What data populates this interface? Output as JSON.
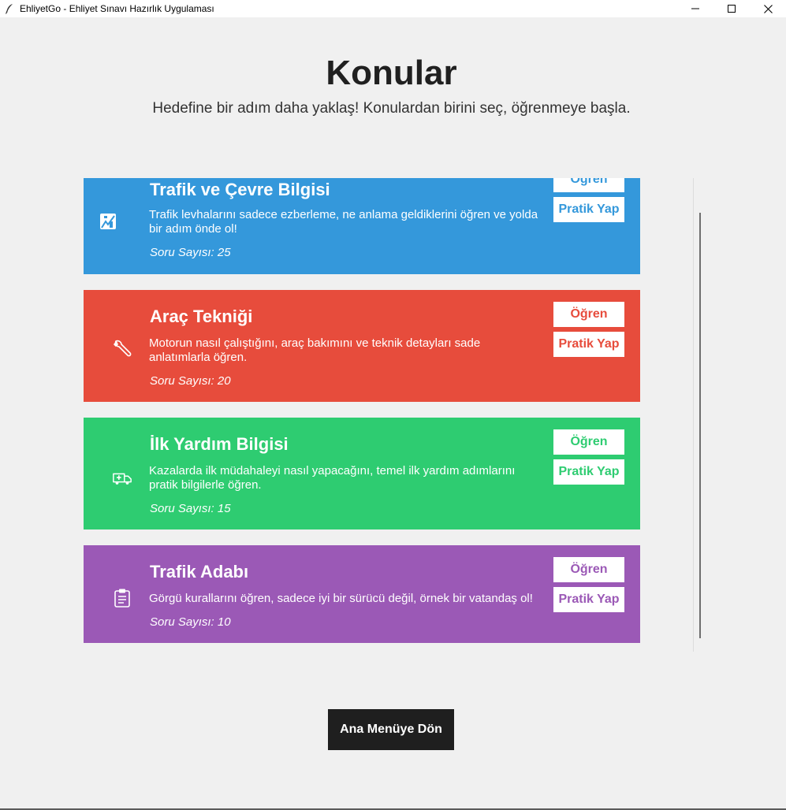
{
  "window": {
    "title": "EhliyetGo - Ehliyet Sınavı Hazırlık Uygulaması"
  },
  "header": {
    "title": "Konular",
    "subtitle": "Hedefine bir adım daha yaklaş! Konulardan birini seç, öğrenmeye başla."
  },
  "topics": [
    {
      "title": "Trafik ve Çevre Bilgisi",
      "description": "Trafik levhalarını sadece ezberleme, ne anlama geldiklerini öğren ve yolda bir adım önde ol!",
      "count": "Soru Sayısı: 25",
      "color": "#3498db",
      "icon": "traffic-sign-icon",
      "learn_label": "Öğren",
      "practice_label": "Pratik Yap"
    },
    {
      "title": "Araç Tekniği",
      "description": "Motorun nasıl çalıştığını, araç bakımını ve teknik detayları sade anlatımlarla öğren.",
      "count": "Soru Sayısı: 20",
      "color": "#e74c3c",
      "icon": "wrench-icon",
      "learn_label": "Öğren",
      "practice_label": "Pratik Yap"
    },
    {
      "title": "İlk Yardım Bilgisi",
      "description": "Kazalarda ilk müdahaleyi nasıl yapacağını, temel ilk yardım adımlarını pratik bilgilerle öğren.",
      "count": "Soru Sayısı: 15",
      "color": "#2ecc71",
      "icon": "ambulance-icon",
      "learn_label": "Öğren",
      "practice_label": "Pratik Yap"
    },
    {
      "title": "Trafik Adabı",
      "description": "Görgü kurallarını öğren, sadece iyi bir sürücü değil, örnek bir vatandaş ol!",
      "count": "Soru Sayısı: 10",
      "color": "#9b59b6",
      "icon": "clipboard-icon",
      "learn_label": "Öğren",
      "practice_label": "Pratik Yap"
    }
  ],
  "footer": {
    "back_label": "Ana Menüye Dön"
  }
}
